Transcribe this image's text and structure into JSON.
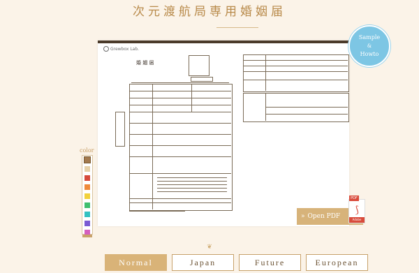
{
  "header": {
    "title": "次元渡航局専用婚姻届"
  },
  "document": {
    "logo_text": "Grewbox Lab.",
    "form_title": "婚 姻 届"
  },
  "sample_badge": {
    "line1": "Sample",
    "amp": "&",
    "line2": "Howto"
  },
  "color_picker": {
    "label": "color",
    "swatches": [
      "#a37a4f",
      "#e7d1a8",
      "#d64a3b",
      "#ef8a3b",
      "#f2d13b",
      "#3fbf6f",
      "#33c2c2",
      "#7b5bd4",
      "#d55fbf"
    ]
  },
  "open_pdf": {
    "label": "Open PDF",
    "badge": "PDF",
    "adobe": "Adobe"
  },
  "tabs": [
    {
      "label": "Normal"
    },
    {
      "label": "Japan"
    },
    {
      "label": "Future"
    },
    {
      "label": "European"
    }
  ]
}
